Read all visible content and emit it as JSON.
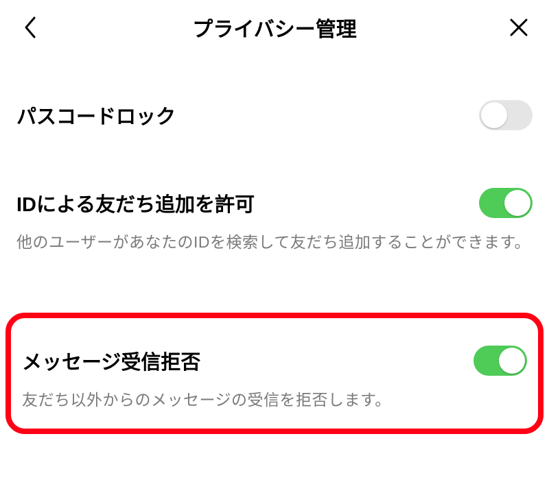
{
  "header": {
    "title": "プライバシー管理"
  },
  "sections": {
    "passcode": {
      "label": "パスコードロック",
      "toggle_on": false
    },
    "id_add": {
      "label": "IDによる友だち追加を許可",
      "subtext": "他のユーザーがあなたのIDを検索して友だち追加することができます。",
      "toggle_on": true
    },
    "message_block": {
      "label": "メッセージ受信拒否",
      "subtext": "友だち以外からのメッセージの受信を拒否します。",
      "toggle_on": true
    }
  },
  "colors": {
    "toggle_on": "#4fcb58",
    "toggle_off": "#e5e5e5",
    "subtext": "#7a7a7a",
    "highlight_border": "#ff0015"
  }
}
